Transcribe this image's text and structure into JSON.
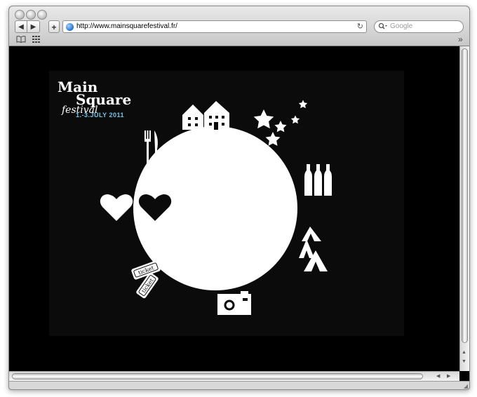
{
  "browser": {
    "url": "http://www.mainsquarefestival.fr/",
    "search_placeholder": "Google",
    "back_label": "◀",
    "forward_label": "▶",
    "add_label": "+",
    "reload_label": "↻",
    "overflow_label": "»"
  },
  "site": {
    "logo_line1": "Main",
    "logo_line2": "Square",
    "logo_script": "festival",
    "logo_dates": "1.-3.JULY 2011",
    "ticket_label": "ticket"
  },
  "colors": {
    "page_background": "#000000",
    "date_accent": "#6ec6e8",
    "graphics": "#ffffff"
  },
  "icons": [
    "house-icon",
    "star-icon",
    "fork-knife-icon",
    "bottle-icon",
    "heart-icon",
    "tent-icon",
    "ticket-icon",
    "camera-icon"
  ]
}
